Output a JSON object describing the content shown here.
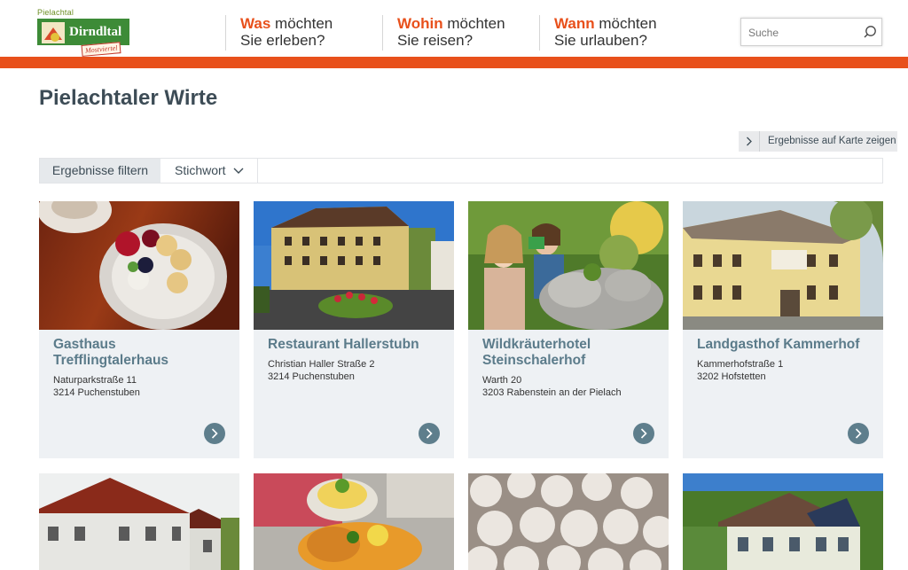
{
  "brand": {
    "top": "Pielachtal",
    "name": "Dirndltal",
    "badge": "Mostviertel"
  },
  "nav": [
    {
      "keyword": "Was",
      "rest1": " möchten",
      "line2": "Sie erleben?"
    },
    {
      "keyword": "Wohin",
      "rest1": " möchten",
      "line2": "Sie reisen?"
    },
    {
      "keyword": "Wann",
      "rest1": " möchten",
      "line2": "Sie urlauben?"
    }
  ],
  "search": {
    "placeholder": "Suche",
    "icon": "search-icon"
  },
  "colors": {
    "accent": "#e8501b",
    "title": "#3d4c56",
    "card_title": "#5b7b8a",
    "card_bg": "#eef1f4"
  },
  "page_title": "Pielachtaler Wirte",
  "map_button": {
    "label": "Ergebnisse auf Karte zeigen",
    "icon": "chevron-right-icon"
  },
  "filter": {
    "label": "Ergebnisse filtern",
    "dropdown": "Stichwort",
    "icon": "chevron-down-icon"
  },
  "cards": [
    {
      "title": "Gasthaus Trefflingtalerhaus",
      "street": "Naturparkstraße 11",
      "city": "3214 Puchenstuben"
    },
    {
      "title": "Restaurant Hallerstubn",
      "street": "Christian Haller Straße 2",
      "city": "3214 Puchenstuben"
    },
    {
      "title": "Wildkräuterhotel Steinschalerhof",
      "street": "Warth 20",
      "city": "3203 Rabenstein an der Pielach"
    },
    {
      "title": "Landgasthof Kammerhof",
      "street": "Kammerhofstraße 1",
      "city": "3202 Hofstetten"
    }
  ]
}
